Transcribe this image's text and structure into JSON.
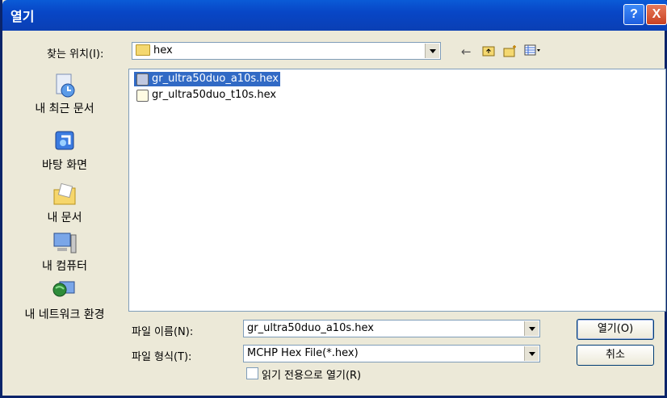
{
  "window": {
    "title": "열기"
  },
  "titlebar": {
    "help_label": "?",
    "close_label": "X"
  },
  "look_in": {
    "label": "찾는 위치(I):",
    "value": "hex"
  },
  "toolbar": {
    "back_icon": "back-arrow-icon",
    "up_icon": "up-folder-icon",
    "new_folder_icon": "new-folder-icon",
    "view_icon": "view-menu-icon"
  },
  "places": [
    {
      "label": "내 최근 문서",
      "icon": "recent-documents-icon"
    },
    {
      "label": "바탕 화면",
      "icon": "desktop-icon"
    },
    {
      "label": "내 문서",
      "icon": "my-documents-icon"
    },
    {
      "label": "내 컴퓨터",
      "icon": "my-computer-icon"
    },
    {
      "label": "내 네트워크 환경",
      "icon": "network-icon"
    }
  ],
  "files": [
    {
      "name": "gr_ultra50duo_a10s.hex",
      "selected": true
    },
    {
      "name": "gr_ultra50duo_t10s.hex",
      "selected": false
    }
  ],
  "filename": {
    "label": "파일 이름(N):",
    "value": "gr_ultra50duo_a10s.hex"
  },
  "filetype": {
    "label": "파일 형식(T):",
    "value": "MCHP Hex File(*.hex)"
  },
  "readonly": {
    "label": "읽기 전용으로 열기(R)",
    "checked": false
  },
  "buttons": {
    "open": "열기(O)",
    "cancel": "취소"
  },
  "colors": {
    "titlebar": "#0a5bd7",
    "selection": "#316ac5",
    "dialog_bg": "#ece9d8"
  }
}
